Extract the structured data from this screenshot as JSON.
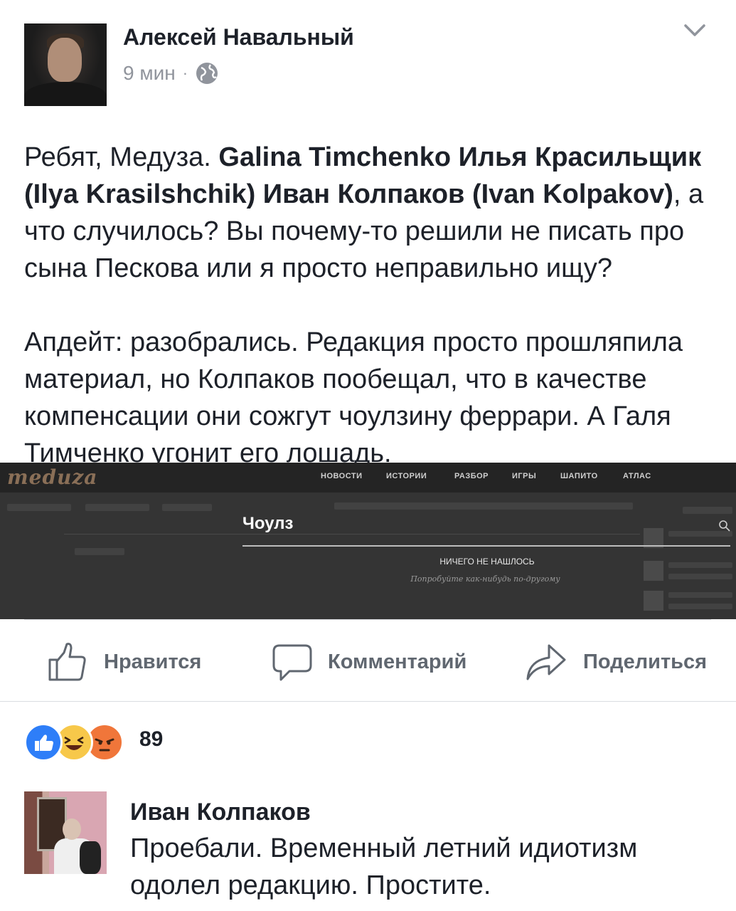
{
  "post": {
    "author": "Алексей Навальный",
    "time": "9 мин",
    "separator": "·",
    "visibility_icon": "globe-icon",
    "menu_icon": "chevron-down-icon",
    "text": {
      "p1_a": "Ребят, Медуза. ",
      "p1_tags": "Galina Timchenko Илья Красильщик (Ilya Krasilshchik) Иван Колпаков (Ivan Kolpakov)",
      "p1_b": ", а что случилось? Вы почему-то решили не писать про сына Пескова или я просто неправильно ищу?",
      "p2": "Апдейт: разобрались. Редакция просто прошляпила материал, но Колпаков пообещал, что в качестве компенсации они сожгут чоулзину феррари. А Галя Тимченко угонит его лошадь."
    }
  },
  "screenshot": {
    "logo": "meduza",
    "nav": [
      "НОВОСТИ",
      "ИСТОРИИ",
      "РАЗБОР",
      "ИГРЫ",
      "ШАПИТО",
      "АТЛАС"
    ],
    "query": "Чоулз",
    "not_found": "НИЧЕГО НЕ НАШЛОСЬ",
    "not_found_hint": "Попробуйте как-нибудь по-другому"
  },
  "actions": {
    "like": "Нравится",
    "comment": "Комментарий",
    "share": "Поделиться"
  },
  "reactions": {
    "count": "89",
    "types": [
      "like",
      "haha",
      "angry"
    ],
    "colors": {
      "like": "#2e7ef8",
      "haha": "#f7c84a",
      "angry": "#f0763a"
    }
  },
  "comment": {
    "author": "Иван Колпаков",
    "text": "Проебали. Временный летний идиотизм одолел редакцию. Простите."
  }
}
